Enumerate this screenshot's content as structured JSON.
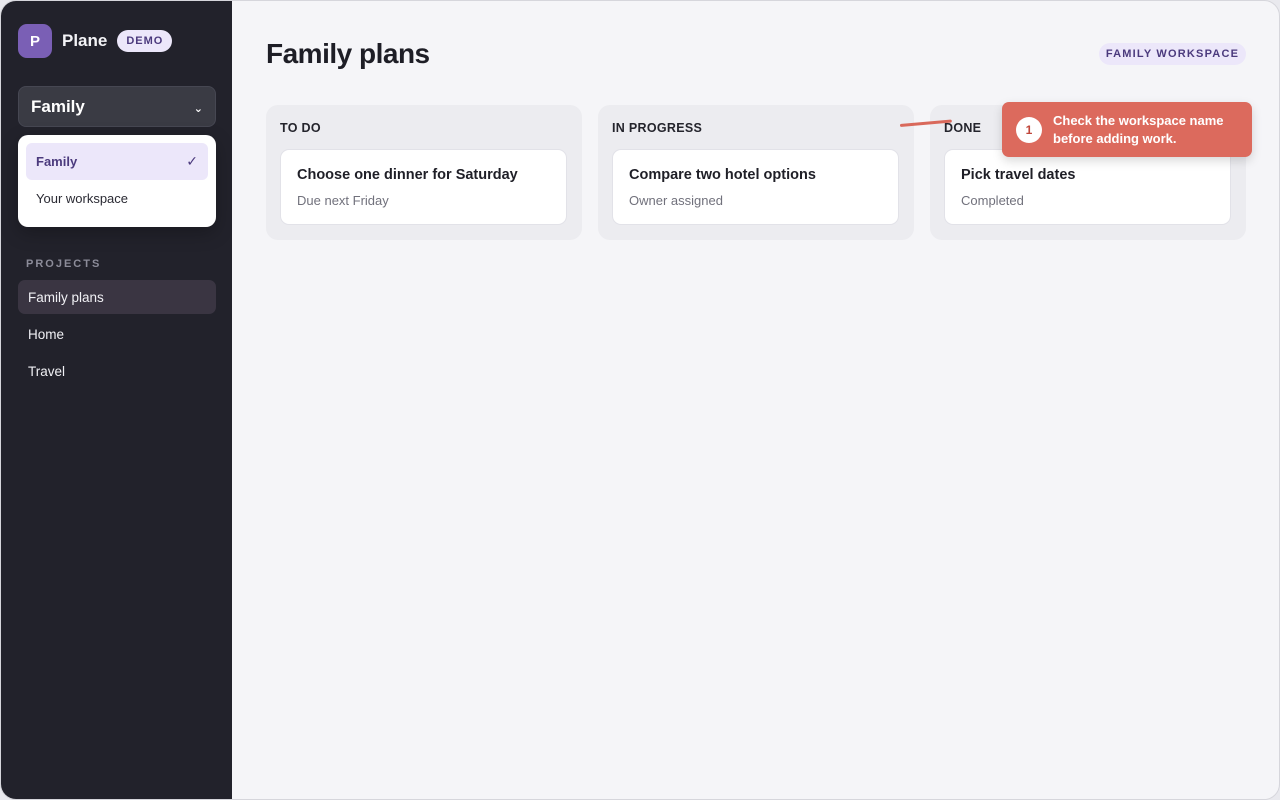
{
  "app": {
    "logo_letter": "P",
    "name": "Plane",
    "badge": "DEMO"
  },
  "workspace_switcher": {
    "current": "Family",
    "options": [
      {
        "label": "Family",
        "selected": true
      },
      {
        "label": "Your workspace",
        "selected": false
      }
    ]
  },
  "sidebar": {
    "projects_heading": "PROJECTS",
    "projects": [
      {
        "label": "Family plans",
        "active": true
      },
      {
        "label": "Home",
        "active": false
      },
      {
        "label": "Travel",
        "active": false
      }
    ]
  },
  "main": {
    "title": "Family plans",
    "workspace_pill": "FAMILY WORKSPACE",
    "columns": [
      {
        "title": "TO DO",
        "card": {
          "title": "Choose one dinner for Saturday",
          "subtitle": "Due next Friday"
        }
      },
      {
        "title": "IN PROGRESS",
        "card": {
          "title": "Compare two hotel options",
          "subtitle": "Owner assigned"
        }
      },
      {
        "title": "DONE",
        "card": {
          "title": "Pick travel dates",
          "subtitle": "Completed"
        }
      }
    ]
  },
  "callout": {
    "step": "1",
    "text": "Check the workspace name before adding work."
  },
  "colors": {
    "sidebar_bg": "#22222b",
    "accent": "#7a5fb5",
    "callout": "#dc6a5d"
  }
}
